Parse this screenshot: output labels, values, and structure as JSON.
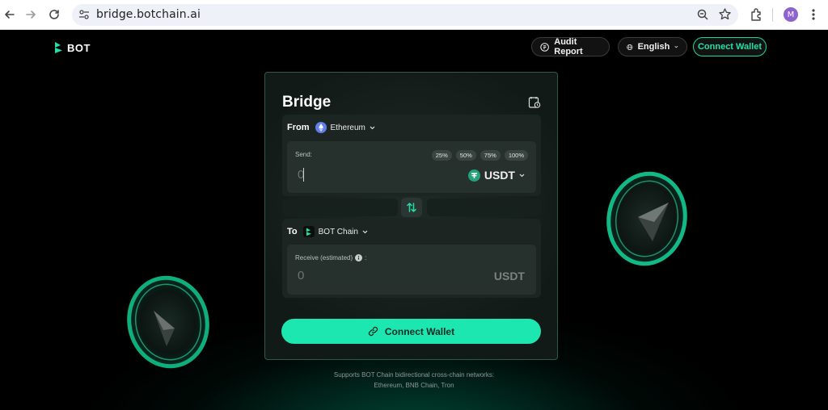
{
  "browser": {
    "url": "bridge.botchain.ai",
    "profile_initial": "M"
  },
  "header": {
    "logo_text": "BOT",
    "audit_label": "Audit Report",
    "language_label": "English",
    "connect_label": "Connect Wallet"
  },
  "bridge": {
    "title": "Bridge",
    "from": {
      "label": "From",
      "chain": "Ethereum",
      "send_label": "Send:",
      "amount": "0",
      "token": "USDT",
      "percents": [
        "25%",
        "50%",
        "75%",
        "100%"
      ]
    },
    "to": {
      "label": "To",
      "chain": "BOT Chain",
      "receive_label": "Receive (estimated)",
      "receive_suffix": ":",
      "amount": "0",
      "token": "USDT"
    },
    "connect_label": "Connect Wallet"
  },
  "footer": {
    "line1": "Supports BOT Chain bidirectional cross-chain networks:",
    "line2": "Ethereum, BNB Chain, Tron"
  },
  "colors": {
    "accent": "#1de7b0",
    "accent_text": "#20e0a8",
    "ethereum": "#627eea",
    "tether": "#26a17b",
    "profile": "#8e63ce"
  },
  "icons": [
    "back-icon",
    "forward-icon",
    "reload-icon",
    "site-settings-icon",
    "zoom-icon",
    "bookmark-star-icon",
    "extensions-icon",
    "menu-kebab-icon",
    "document-icon",
    "globe-icon",
    "chevron-down-icon",
    "history-icon",
    "ethereum-icon",
    "tether-icon",
    "botchain-icon",
    "swap-icon",
    "info-icon",
    "link-icon"
  ]
}
